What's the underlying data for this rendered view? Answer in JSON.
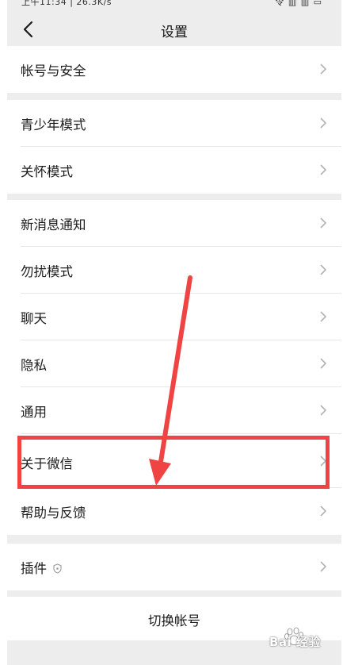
{
  "status_bar": {
    "left": "上午11:34 | 26.3K/s",
    "right": "令 ▥ ▥ ▭"
  },
  "nav": {
    "title": "设置"
  },
  "groups": {
    "account": {
      "items": [
        "帐号与安全"
      ]
    },
    "modes": {
      "items": [
        "青少年模式",
        "关怀模式"
      ]
    },
    "general": {
      "items": [
        "新消息通知",
        "勿扰模式",
        "聊天",
        "隐私",
        "通用",
        "关于微信",
        "帮助与反馈"
      ]
    },
    "plugins": {
      "items": [
        "插件"
      ]
    }
  },
  "switch_account": {
    "label": "切换帐号"
  },
  "annotation": {
    "highlight_color": "#f04343"
  },
  "watermark": {
    "text": "Bai 经验"
  },
  "colors": {
    "background": "#ededed",
    "card": "#ffffff",
    "divider": "#e7e7e7",
    "chevron": "#b2b2b2"
  }
}
